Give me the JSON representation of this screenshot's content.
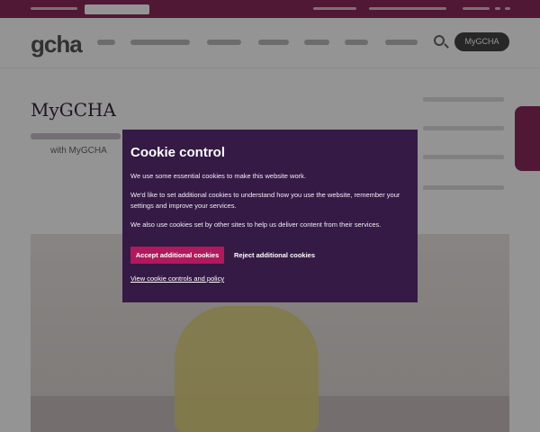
{
  "header": {
    "logo_text": "gcha",
    "account_button_label": "MyGCHA"
  },
  "main": {
    "page_title": "MyGCHA",
    "intro_fragment": "with MyGCHA"
  },
  "cookie_dialog": {
    "title": "Cookie control",
    "paragraph_1": "We use some essential cookies to make this website work.",
    "paragraph_2": "We'd like to set additional cookies to understand how you use the website, remember your settings and improve your services.",
    "paragraph_3": "We also use cookies set by other sites to help us deliver content from their services.",
    "accept_label": "Accept additional cookies",
    "reject_label": "Reject additional cookies",
    "policy_link_label": "View cookie controls and policy"
  },
  "colors": {
    "brand_magenta": "#8a2a5c",
    "dialog_background": "#351a45",
    "accept_button": "#b0195c"
  },
  "icons": {
    "search": "search-icon"
  }
}
